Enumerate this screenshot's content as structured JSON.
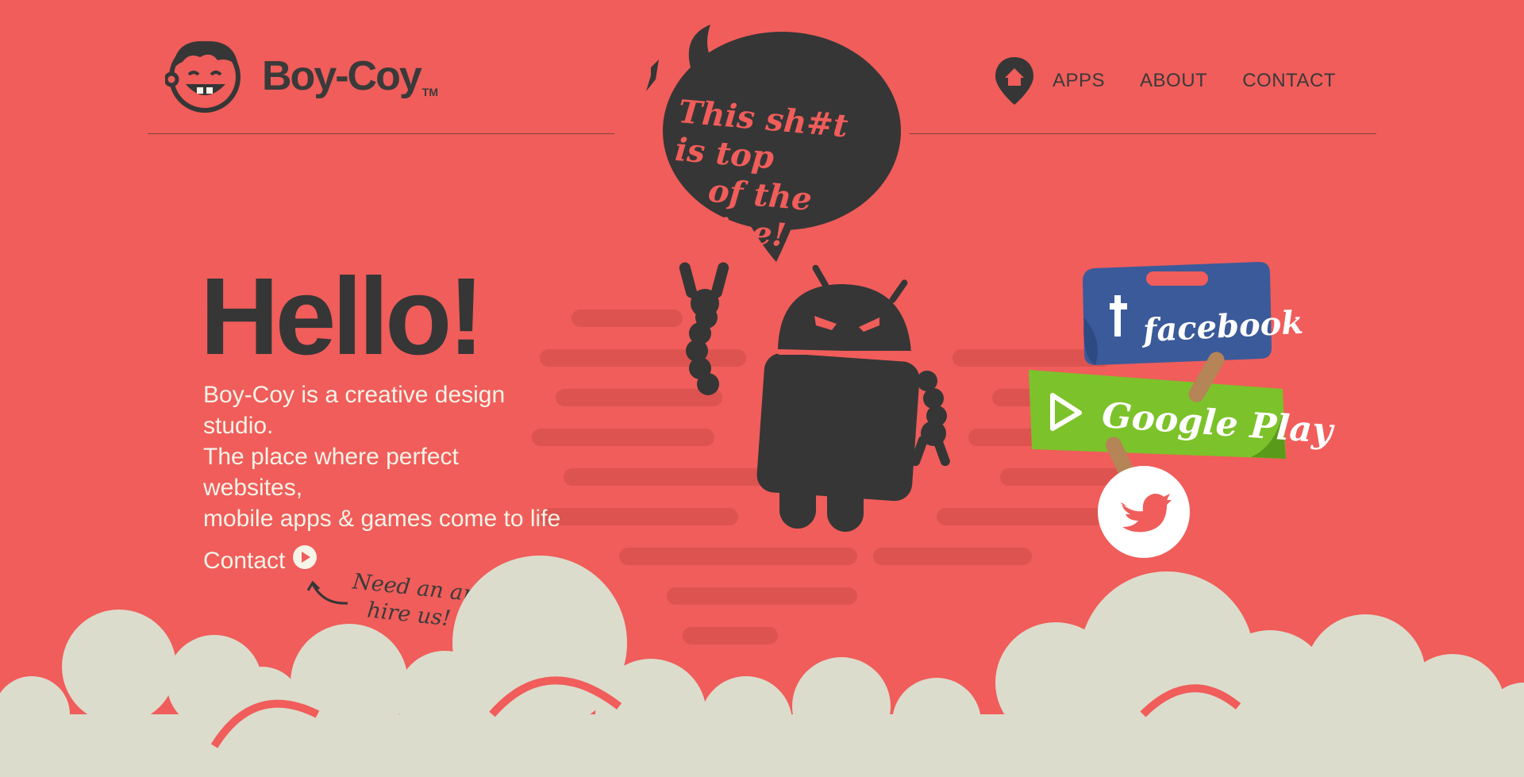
{
  "header": {
    "brand": "Boy-Coy",
    "brand_tm": "TM",
    "nav": [
      {
        "label": "APPS"
      },
      {
        "label": "ABOUT"
      },
      {
        "label": "CONTACT"
      }
    ],
    "home_icon": "home-pin-icon"
  },
  "speech_bubble": {
    "line1": "This sh#t is top",
    "line2": "of the line!"
  },
  "hero": {
    "heading": "Hello!",
    "tagline_lines": [
      "Boy-Coy is a creative design",
      "studio.",
      "The place where perfect",
      "websites,",
      "mobile apps & games come to life"
    ],
    "contact_label": "Contact",
    "note_lines": [
      "Need an app?",
      "hire us!"
    ]
  },
  "social": {
    "facebook_label": "facebook",
    "google_play_label": "Google Play",
    "twitter_icon": "twitter-bird-icon"
  },
  "colors": {
    "background": "#f05d5a",
    "dark": "#363636",
    "cream": "#dcdccc",
    "facebook": "#3b5a9a",
    "google_play": "#7cc22a"
  }
}
